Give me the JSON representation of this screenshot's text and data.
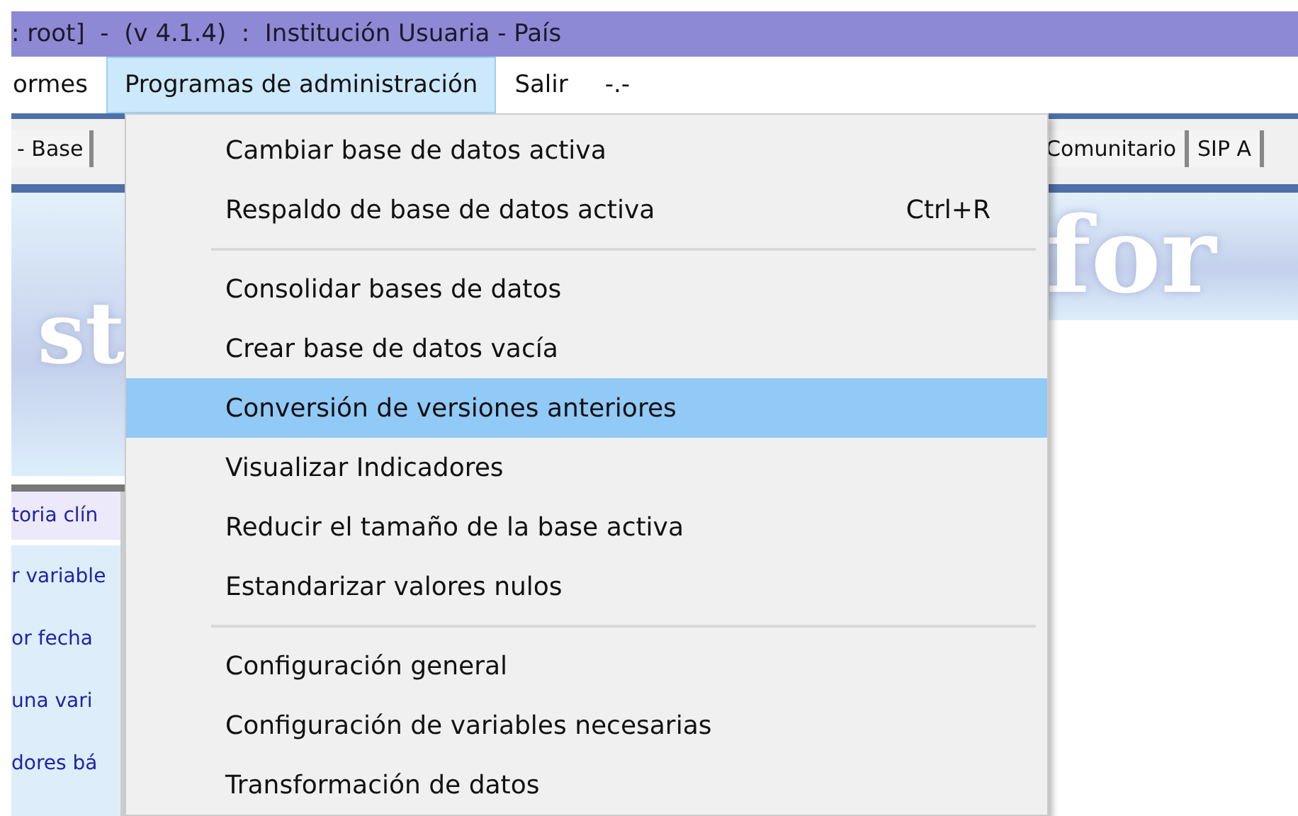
{
  "window": {
    "title": ": root]  -  (v 4.1.4)  :  Institución Usuaria - País"
  },
  "menu_bar": [
    {
      "label": "ormes",
      "selected": false
    },
    {
      "label": "Programas de administración",
      "selected": true
    },
    {
      "label": "Salir",
      "selected": false
    },
    {
      "label": "-.-",
      "selected": false
    }
  ],
  "tabs_left": [
    "- Base"
  ],
  "tabs_right": [
    "Comunitario",
    "SIP A"
  ],
  "banner_left": "st",
  "banner_right": "for",
  "side_links": [
    {
      "label": "toria clín",
      "selected": true
    },
    {
      "label": "r variable",
      "selected": false
    },
    {
      "label": "or fecha",
      "selected": false
    },
    {
      "label": "una vari",
      "selected": false
    },
    {
      "label": "dores bá",
      "selected": false
    }
  ],
  "dropdown": [
    {
      "kind": "item",
      "label": "Cambiar base de datos activa",
      "selected": false
    },
    {
      "kind": "item",
      "label": "Respaldo de base de datos activa",
      "shortcut": "Ctrl+R",
      "selected": false
    },
    {
      "kind": "separator"
    },
    {
      "kind": "item",
      "label": "Consolidar bases de datos",
      "selected": false
    },
    {
      "kind": "item",
      "label": "Crear base de datos vacía",
      "selected": false
    },
    {
      "kind": "item",
      "label": "Conversión de versiones anteriores",
      "selected": true
    },
    {
      "kind": "item",
      "label": "Visualizar Indicadores",
      "selected": false
    },
    {
      "kind": "item",
      "label": "Reducir el tamaño de la base activa",
      "selected": false
    },
    {
      "kind": "item",
      "label": "Estandarizar valores nulos",
      "selected": false
    },
    {
      "kind": "separator"
    },
    {
      "kind": "item",
      "label": "Configuración general",
      "selected": false
    },
    {
      "kind": "item",
      "label": "Configuración de variables necesarias",
      "selected": false
    },
    {
      "kind": "item",
      "label": "Transformación de datos",
      "selected": false
    }
  ]
}
